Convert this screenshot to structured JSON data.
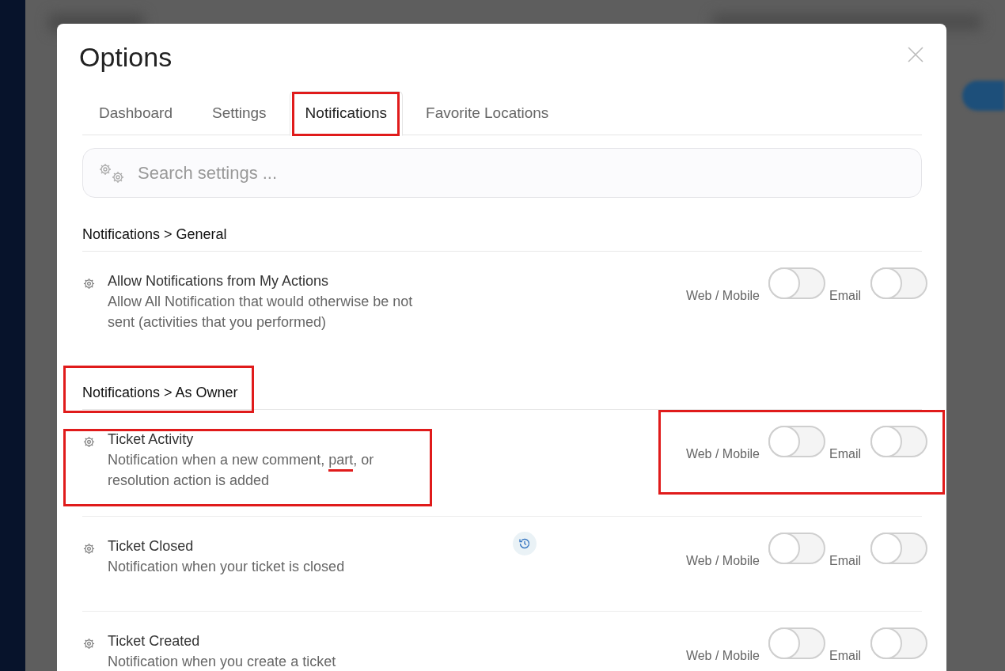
{
  "dialog": {
    "title": "Options"
  },
  "tabs": [
    {
      "label": "Dashboard",
      "selected": false,
      "highlighted": false
    },
    {
      "label": "Settings",
      "selected": false,
      "highlighted": false
    },
    {
      "label": "Notifications",
      "selected": true,
      "highlighted": true
    },
    {
      "label": "Favorite Locations",
      "selected": false,
      "highlighted": false
    }
  ],
  "search": {
    "placeholder": "Search settings ..."
  },
  "sections": [
    {
      "heading": "Notifications > General",
      "highlighted": false,
      "settings": [
        {
          "title": "Allow Notifications from My Actions",
          "description": [
            {
              "text": "Allow All Notification that would otherwise be not sent (activities that you performed)",
              "underlined": false
            }
          ],
          "history": false,
          "highlighted": false,
          "web_label": "Web / Mobile",
          "web_on": false,
          "email_label": "Email",
          "email_on": false
        }
      ]
    },
    {
      "heading": "Notifications > As Owner",
      "highlighted": true,
      "settings": [
        {
          "title": "Ticket Activity",
          "description": [
            {
              "text": "Notification when a new comment, ",
              "underlined": false
            },
            {
              "text": "part",
              "underlined": true
            },
            {
              "text": ", or resolution action is added",
              "underlined": false
            }
          ],
          "history": false,
          "highlighted": true,
          "web_label": "Web / Mobile",
          "web_on": false,
          "email_label": "Email",
          "email_on": false
        },
        {
          "title": "Ticket Closed",
          "description": [
            {
              "text": "Notification when your ticket is closed",
              "underlined": false
            }
          ],
          "history": true,
          "highlighted": false,
          "web_label": "Web / Mobile",
          "web_on": false,
          "email_label": "Email",
          "email_on": false
        },
        {
          "title": "Ticket Created",
          "description": [
            {
              "text": "Notification when you create a ticket",
              "underlined": false
            }
          ],
          "history": false,
          "highlighted": false,
          "web_label": "Web / Mobile",
          "web_on": false,
          "email_label": "Email",
          "email_on": false
        }
      ]
    }
  ]
}
